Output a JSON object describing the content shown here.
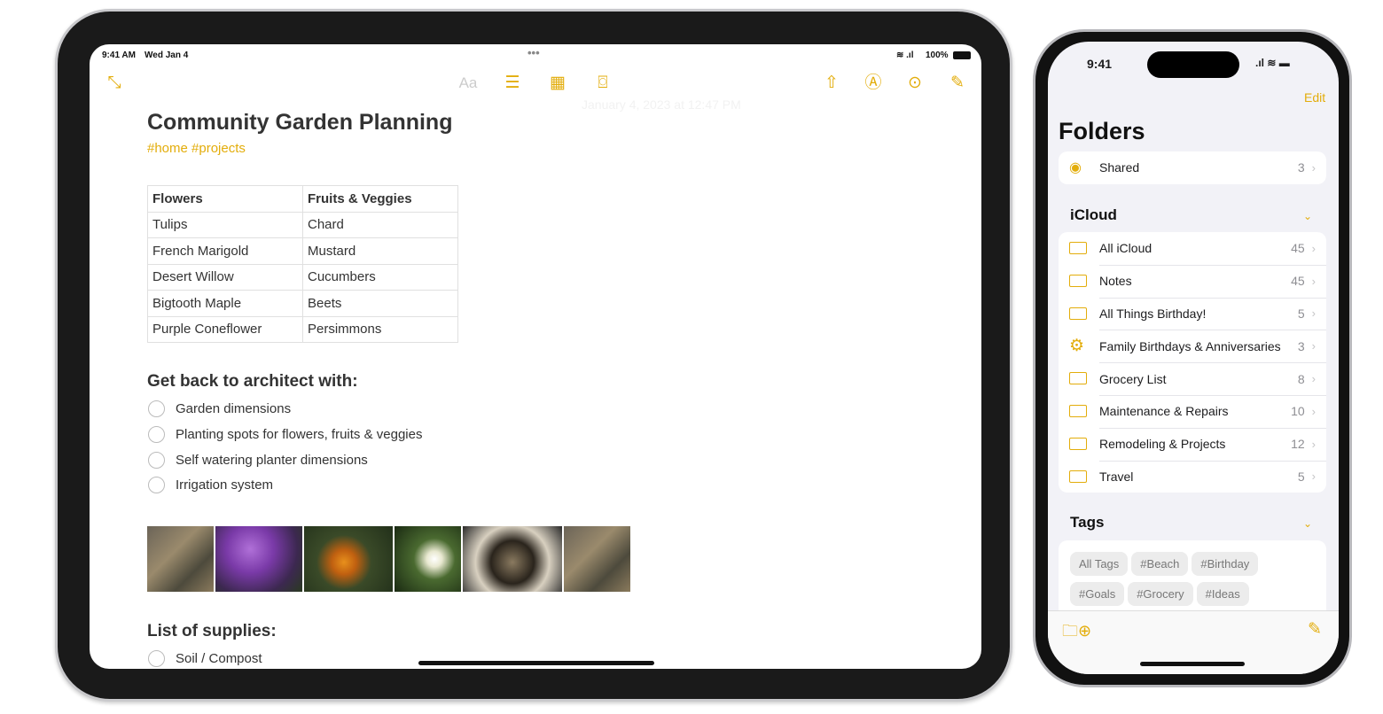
{
  "ipad": {
    "status": {
      "time": "9:41 AM",
      "date": "Wed Jan 4",
      "battery": "100%"
    },
    "toolbar": {
      "format_label": "Aa",
      "timestamp": "January 4, 2023 at 12:47 PM"
    },
    "note": {
      "title": "Community Garden Planning",
      "tags": "#home #projects",
      "table": {
        "headers": [
          "Flowers",
          "Fruits & Veggies"
        ],
        "rows": [
          [
            "Tulips",
            "Chard"
          ],
          [
            "French Marigold",
            "Mustard"
          ],
          [
            "Desert Willow",
            "Cucumbers"
          ],
          [
            "Bigtooth Maple",
            "Beets"
          ],
          [
            "Purple Coneflower",
            "Persimmons"
          ]
        ]
      },
      "checklist_heading": "Get back to architect with:",
      "checklist": [
        "Garden dimensions",
        "Planting spots for flowers, fruits & veggies",
        "Self watering planter dimensions",
        "Irrigation system"
      ],
      "supplies_heading": "List of supplies:",
      "supplies": [
        "Soil / Compost"
      ]
    }
  },
  "iphone": {
    "status": {
      "time": "9:41"
    },
    "edit_label": "Edit",
    "title": "Folders",
    "shared": {
      "label": "Shared",
      "count": "3"
    },
    "icloud_heading": "iCloud",
    "folders": [
      {
        "label": "All iCloud",
        "count": "45",
        "icon": "folder-icon"
      },
      {
        "label": "Notes",
        "count": "45",
        "icon": "folder-icon"
      },
      {
        "label": "All Things Birthday!",
        "count": "5",
        "icon": "folder-icon"
      },
      {
        "label": "Family Birthdays & Anniversaries",
        "count": "3",
        "icon": "gear-icon"
      },
      {
        "label": "Grocery List",
        "count": "8",
        "icon": "folder-icon"
      },
      {
        "label": "Maintenance & Repairs",
        "count": "10",
        "icon": "folder-icon"
      },
      {
        "label": "Remodeling & Projects",
        "count": "12",
        "icon": "folder-icon"
      },
      {
        "label": "Travel",
        "count": "5",
        "icon": "folder-icon"
      }
    ],
    "tags_heading": "Tags",
    "tags": [
      "All Tags",
      "#Beach",
      "#Birthday",
      "#Goals",
      "#Grocery",
      "#Ideas"
    ]
  },
  "colors": {
    "accent": "#e3ad0b"
  }
}
